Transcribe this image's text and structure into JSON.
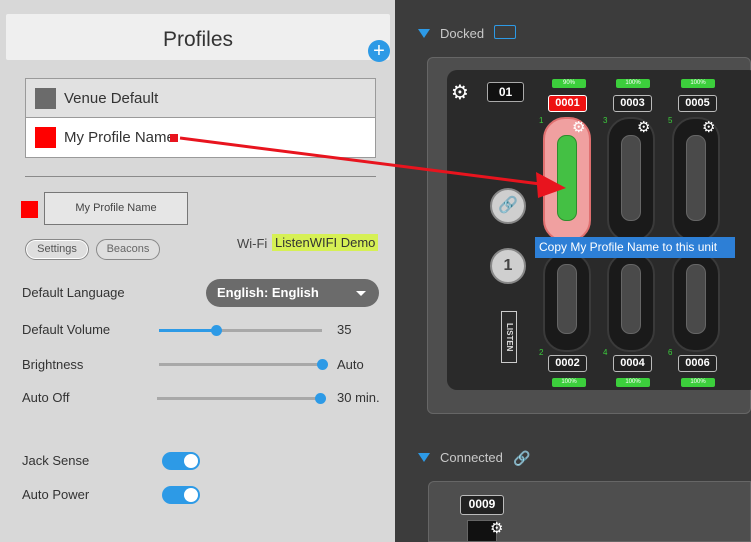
{
  "profiles_panel": {
    "title": "Profiles",
    "add_icon": "plus-circle-icon",
    "profiles": [
      {
        "name": "Venue Default",
        "color": "#6b6b6b"
      },
      {
        "name": "My Profile Name",
        "color": "#ff0000"
      }
    ],
    "selected_profile_name": "My Profile Name",
    "selected_color": "#ff0000",
    "tabs": {
      "settings": "Settings",
      "beacons": "Beacons"
    },
    "wifi_label": "Wi-Fi",
    "wifi_value": "ListenWIFI Demo",
    "language_label": "Default Language",
    "language_value": "English: English",
    "volume_label": "Default Volume",
    "volume_value": "35",
    "volume_level": 0.35,
    "brightness_label": "Brightness",
    "brightness_value": "Auto",
    "brightness_level": 1.0,
    "auto_off_label": "Auto Off",
    "auto_off_value": "30 min.",
    "auto_off_level": 1.0,
    "jack_sense_label": "Jack Sense",
    "jack_sense_on": true,
    "auto_power_label": "Auto Power",
    "auto_power_on": true
  },
  "dock_panel": {
    "docked_label": "Docked",
    "dock_number": "01",
    "top_units": [
      {
        "id": "0001",
        "battery": "90%",
        "slot": "1",
        "selected": true
      },
      {
        "id": "0003",
        "battery": "100%",
        "slot": "3",
        "selected": false
      },
      {
        "id": "0005",
        "battery": "100%",
        "slot": "5",
        "selected": false
      }
    ],
    "bottom_units": [
      {
        "id": "0002",
        "battery": "100%",
        "slot": "2"
      },
      {
        "id": "0004",
        "battery": "100%",
        "slot": "4"
      },
      {
        "id": "0006",
        "battery": "100%",
        "slot": "6"
      }
    ],
    "side_button_2": "1",
    "logo_text": "LISTEN",
    "tooltip": "Copy My Profile Name to this unit",
    "connected_label": "Connected",
    "connected_unit": "0009",
    "accent_color": "#2d9ae6"
  }
}
